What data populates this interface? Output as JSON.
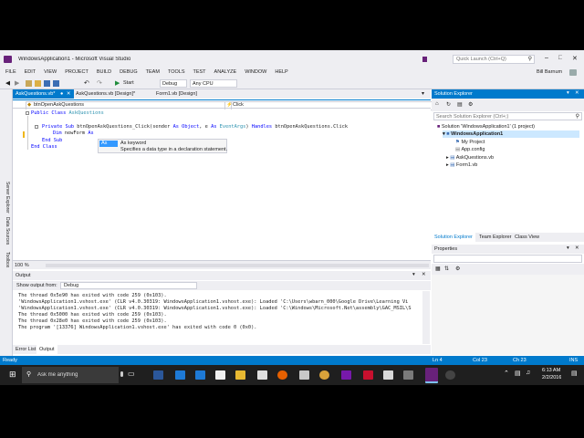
{
  "window": {
    "title": "WindowsApplication1 - Microsoft Visual Studio",
    "quick_launch_placeholder": "Quick Launch (Ctrl+Q)",
    "user": "Bill Barnum"
  },
  "menu": [
    "FILE",
    "EDIT",
    "VIEW",
    "PROJECT",
    "BUILD",
    "DEBUG",
    "TEAM",
    "TOOLS",
    "TEST",
    "ANALYZE",
    "WINDOW",
    "HELP"
  ],
  "toolbar": {
    "start_label": "Start",
    "config": "Debug",
    "platform": "Any CPU"
  },
  "side_tabs": [
    "Server Explorer",
    "Data Sources",
    "Toolbox"
  ],
  "doc_tabs": [
    {
      "label": "AskQuestions.vb*",
      "active": true
    },
    {
      "label": "AskQuestions.vb [Design]*",
      "active": false
    },
    {
      "label": "Form1.vb [Design]",
      "active": false
    }
  ],
  "navbar": {
    "left": "btnOpenAskQuestions",
    "right": "Click"
  },
  "code": {
    "line1_kw": "Public Class",
    "line1_name": "AskQuestions",
    "line2_kw1": "Private Sub",
    "line2_name": "btnOpenAskQuestions_Click(sender",
    "line2_as1": "As",
    "line2_type1": "Object",
    "line2_e": ", e",
    "line2_as2": "As",
    "line2_type2": "EventArgs",
    "line2_handles": ")",
    "line2_kw_handles": "Handles",
    "line2_target": "btnOpenAskQuestions.Click",
    "line3_kw": "Dim",
    "line3_name": "newForm",
    "line3_as": "As",
    "line4": "End Sub",
    "line5": "End Class"
  },
  "intellisense": {
    "item": "As",
    "title": "As keyword",
    "desc": "Specifies a data type in a declaration statement."
  },
  "zoom": "100 %",
  "output": {
    "title": "Output",
    "show_from_label": "Show output from:",
    "show_from_value": "Debug",
    "lines": [
      "The thread 0x5e90 has exited with code 259 (0x103).",
      "'WindowsApplication1.vshost.exe' (CLR v4.0.30319: WindowsApplication1.vshost.exe): Loaded 'C:\\Users\\wbarn_000\\Google Drive\\Learning Vi",
      "'WindowsApplication1.vshost.exe' (CLR v4.0.30319: WindowsApplication1.vshost.exe): Loaded 'C:\\Windows\\Microsoft.Net\\assembly\\GAC_MSIL\\S",
      "The thread 0x5000 has exited with code 259 (0x103).",
      "The thread 0x28e0 has exited with code 259 (0x103).",
      "The program '[13376] WindowsApplication1.vshost.exe' has exited with code 0 (0x0)."
    ]
  },
  "bottom_tabs": [
    "Error List",
    "Output"
  ],
  "solution_explorer": {
    "title": "Solution Explorer",
    "search_placeholder": "Search Solution Explorer (Ctrl+;)",
    "nodes": [
      {
        "label": "Solution 'WindowsApplication1' (1 project)",
        "indent": 0,
        "bold": false
      },
      {
        "label": "WindowsApplication1",
        "indent": 1,
        "bold": true
      },
      {
        "label": "My Project",
        "indent": 2,
        "bold": false
      },
      {
        "label": "App.config",
        "indent": 2,
        "bold": false
      },
      {
        "label": "AskQuestions.vb",
        "indent": 2,
        "bold": false
      },
      {
        "label": "Form1.vb",
        "indent": 2,
        "bold": false
      }
    ],
    "tabs": [
      "Solution Explorer",
      "Team Explorer",
      "Class View"
    ]
  },
  "properties": {
    "title": "Properties"
  },
  "status": {
    "ready": "Ready",
    "ln": "Ln 4",
    "col": "Col 23",
    "ch": "Ch 23",
    "ins": "INS"
  },
  "taskbar": {
    "search_placeholder": "Ask me anything",
    "time": "6:13 AM",
    "date": "2/2/2016"
  },
  "colors": {
    "accent": "#007acc",
    "vs_purple": "#68217a",
    "keyword": "#0000ff",
    "type": "#2b91af"
  }
}
